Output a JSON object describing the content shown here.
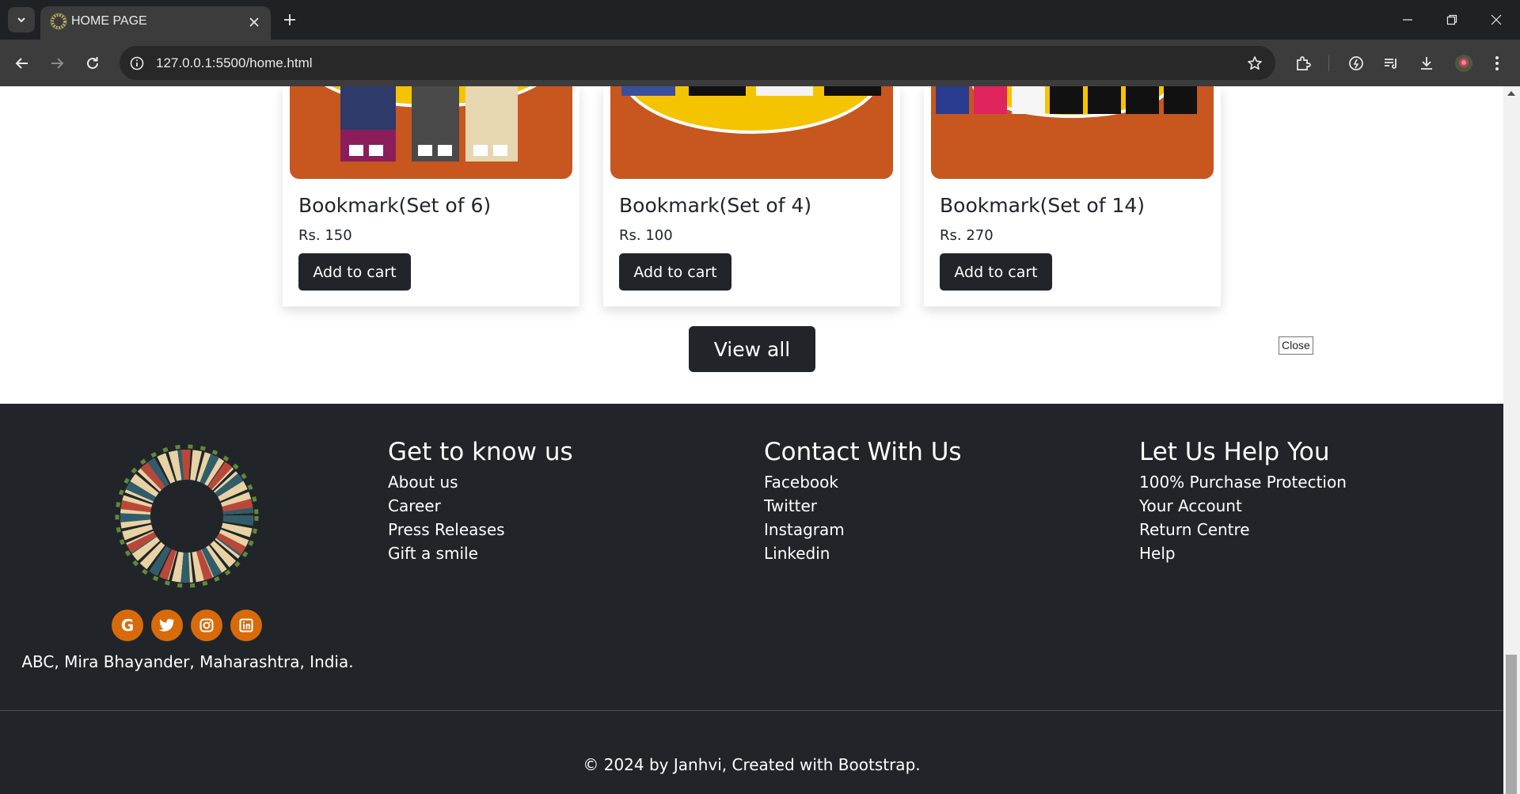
{
  "browser": {
    "tab_title": "HOME PAGE",
    "url": "127.0.0.1:5500/home.html"
  },
  "products": [
    {
      "title": "Bookmark(Set of 6)",
      "price": "Rs. 150",
      "button": "Add to cart"
    },
    {
      "title": "Bookmark(Set of 4)",
      "price": "Rs. 100",
      "button": "Add to cart"
    },
    {
      "title": "Bookmark(Set of 14)",
      "price": "Rs. 270",
      "button": "Add to cart"
    }
  ],
  "view_all_label": "View all",
  "tooltip": "Close",
  "footer": {
    "social": [
      "google-icon",
      "twitter-icon",
      "instagram-icon",
      "linkedin-icon"
    ],
    "address": "ABC, Mira Bhayander, Maharashtra, India.",
    "col1": {
      "heading": "Get to know us",
      "links": [
        "About us",
        "Career",
        "Press Releases",
        "Gift a smile"
      ]
    },
    "col2": {
      "heading": "Contact With Us",
      "links": [
        "Facebook",
        "Twitter",
        "Instagram",
        "Linkedin"
      ]
    },
    "col3": {
      "heading": "Let Us Help You",
      "links": [
        "100% Purchase Protection",
        "Your Account",
        "Return Centre",
        "Help"
      ]
    },
    "copyright": "© 2024 by Janhvi, Created with Bootstrap."
  },
  "colors": {
    "accent": "#d96a0a",
    "dark": "#212529",
    "card_image_bg": "#c8561f",
    "card_image_circle": "#f5c400"
  }
}
